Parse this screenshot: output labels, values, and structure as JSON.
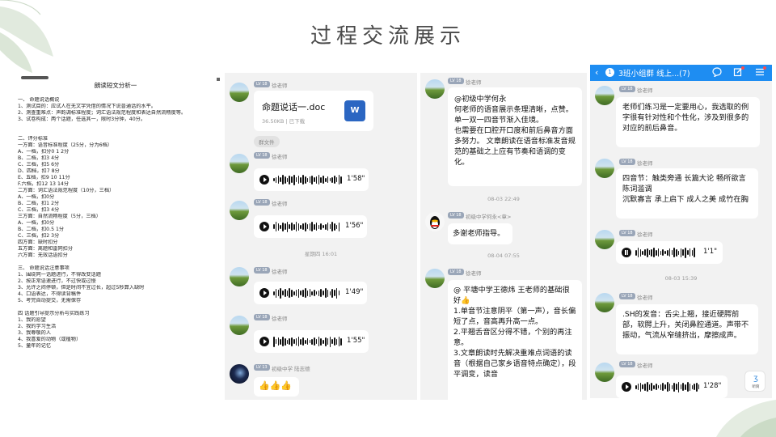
{
  "slide": {
    "title": "过程交流展示"
  },
  "document": {
    "title": "朗读短文分析一",
    "lines": [
      "一、   命题说话概说",
      "1、测试目的：应试人在无文字凭借的情况下说普通话的水平。",
      "2、测查重难点：声韵调标准程度；词汇语法规范程度和表达自然流畅度等。",
      "3、试卷构成：两个话题，任选其一，限时3分钟，40分。",
      "",
      "",
      "二、评分标准",
      "一方面：语音标准程度（25分，分为6档）",
      "A、一档，扣分0 1 2分",
      "B、二档，扣3    4分",
      "C、三档，扣5 6分",
      "D、四档，扣7 8分",
      "E、五档，扣9 10 11分",
      "F.六档，扣12 13 14分",
      "二方面：词汇语法规范程度（10分，三档）",
      "A、一档，扣0分",
      "B、二档，扣1 2分",
      "C、三档，扣3 4分",
      "三方面：自然流畅程度（5分，三档）",
      "A、一档，扣0分",
      "B、二档，扣0.5 1分",
      "C、三档，扣2 3分",
      "四方面：缺时扣分",
      "五方面：离题和雷同扣分",
      "六方面：无效话语扣分",
      "",
      "三、   命题说话注意事项",
      "1、围绕同一话题进行，不得改变话题",
      "2、按正常语速进行，不过快或过慢",
      "3、允许之间停顿，但是时间不宜过长，超过5秒算入缺时",
      "4、口语表达，不得读背稿件",
      "5、考完自动提交，无需保存",
      "",
      "四  话题引导提示分析与实践练习",
      "1、我的愿望",
      "2、我的学习生活",
      "3、我尊敬的人",
      "4、我喜爱的动物（或植物）",
      "5、童年的记忆"
    ]
  },
  "chat2": {
    "badge": "LV 18",
    "sender": "徐老师",
    "file": {
      "name": "命题说话一.doc",
      "meta": "36.50KB | 已下载",
      "icon": "W"
    },
    "chip": "群文件",
    "voice1": "1'58\"",
    "voice2": "1'56\"",
    "time1": "星期四 16:01",
    "voice3": "1'49\"",
    "voice4": "1'55\"",
    "badge2": "LV 13",
    "sender2": "初级中学 陆志德",
    "emoji": "👍👍👍"
  },
  "chat3": {
    "badge": "LV 18",
    "sender": "徐老师",
    "msg1": "@初级中学何永\n    何老师的语音展示条理清晰，点赞。单一双一四音节渐入佳境。\n    也需要在口腔开口度和前后鼻音方面多努力。       文章朗读在语音标准发音规范的基础之上应有节奏和语调的变化。",
    "time1": "08-03 22:49",
    "badge2": "LV 18",
    "sender2": "初级中学何永<章>",
    "msg2": "多谢老师指导。",
    "time2": "08-04 07:55",
    "msg3": "@ 平塘中学王德炜 王老师的基础很好👍\n1.单音节注意阴平（第一声），音长偏短了点，音高再升高一点。\n2.平翘舌音区分得不错，个别的再注意。\n3.文章朗读时先解决重难点词语的读音（根据自己家乡语音特点确定），段平调变，读音"
  },
  "chat4": {
    "header": {
      "count": "1",
      "title": "3班小组群 线上...(7)"
    },
    "badge": "LV 18",
    "sender": "徐老师",
    "msg1": "老师们练习是一定要用心，我选取的例字很有针对性和个性化，涉及到很多的对应的前后鼻音。",
    "msg2": "四音节：触类旁通 长篇大论 畅所欲言 陈词滥调\n         沉默寡言 承上启下 成人之美 成竹在胸",
    "voice1": "1'1\"",
    "time1": "08-03 15:39",
    "msg3": ".SH的发音：舌尖上翘，接近硬腭前部，软腭上升，关闭鼻腔通道。声带不振动，气流从窄缝挤出，摩擦成声。",
    "voice2": "1'28\"",
    "listen": "听筒"
  }
}
